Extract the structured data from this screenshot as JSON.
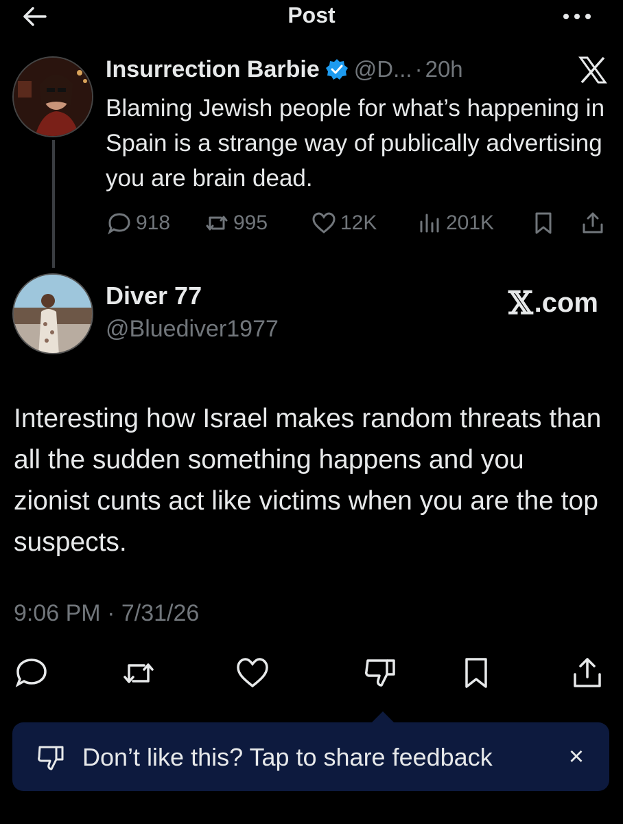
{
  "header": {
    "title": "Post",
    "back_icon": "arrow-left-icon",
    "more_icon": "more-horizontal-icon"
  },
  "quoted_post": {
    "display_name": "Insurrection Barbie",
    "handle": "@D...",
    "separator": "·",
    "time": "20h",
    "text": "Blaming Jewish people for what’s happening in Spain is a strange way of publically advertising you are brain dead.",
    "stats": {
      "replies": "918",
      "reposts": "995",
      "likes": "12K",
      "views": "201K"
    },
    "verified_color": "#1d9bf0"
  },
  "main_post": {
    "display_name": "Diver 77",
    "handle": "@Bluediver1977",
    "source_label": ".com",
    "text": "Interesting how Israel makes random threats than all the sudden something happens and you zionist cunts act like victims when you are the top suspects.",
    "timestamp": "9:06 PM · 7/31/26"
  },
  "feedback_banner": {
    "text": "Don’t like this? Tap to share feedback",
    "close_label": "×",
    "background": "#0d1a3e"
  },
  "colors": {
    "background": "#000000",
    "text_primary": "#e7e9ea",
    "text_secondary": "#71767b"
  }
}
